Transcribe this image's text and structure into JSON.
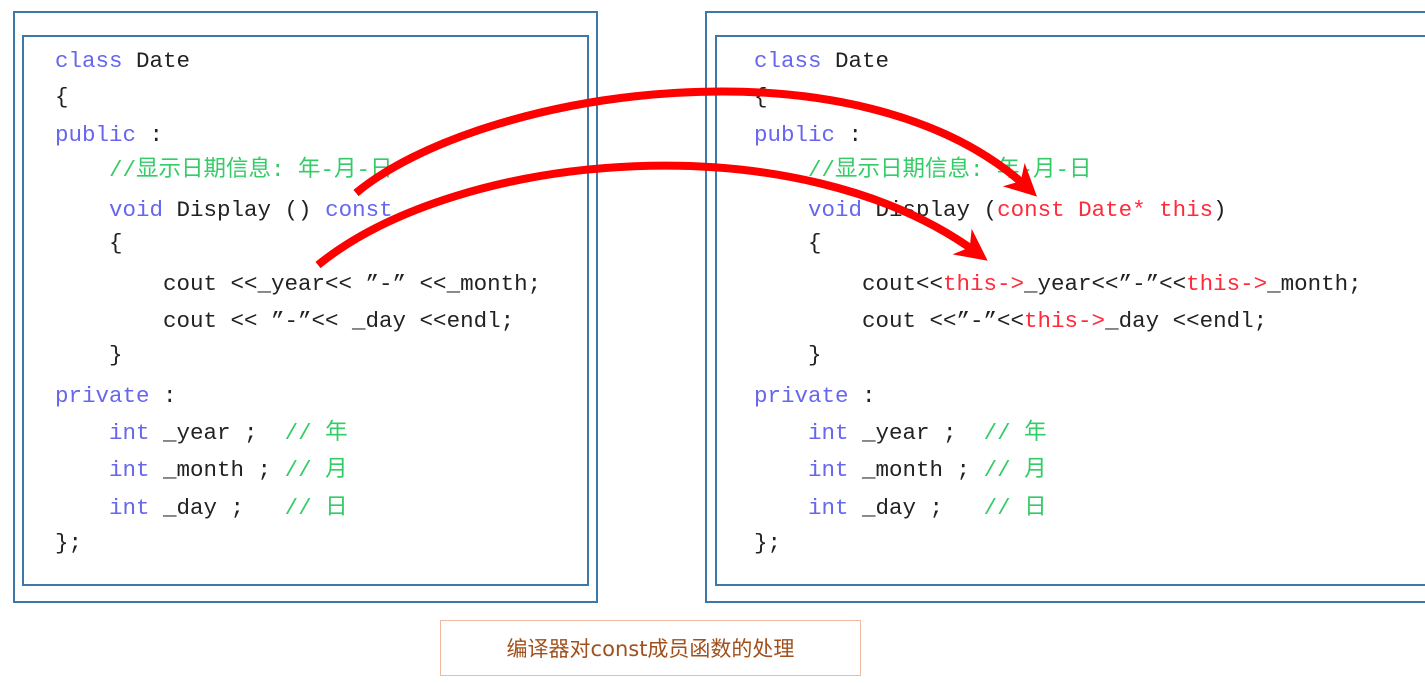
{
  "left_code": [
    [
      [
        "class ",
        "kw"
      ],
      [
        "Date",
        "tx"
      ]
    ],
    [
      [
        "{",
        "tx"
      ]
    ],
    [
      [
        "public",
        "kw"
      ],
      [
        " :",
        "tx"
      ]
    ],
    [
      [
        "    ",
        "tx"
      ],
      [
        "//显示日期信息: 年-月-日",
        "cm"
      ]
    ],
    [
      [
        "    ",
        "tx"
      ],
      [
        "void",
        "kw"
      ],
      [
        " Display () ",
        "tx"
      ],
      [
        "const",
        "kw"
      ]
    ],
    [
      [
        "    {",
        "tx"
      ]
    ],
    [
      [
        "        cout <<_year<< ”-” <<_month;",
        "tx"
      ]
    ],
    [
      [
        "        cout << ”-”<< _day <<endl;",
        "tx"
      ]
    ],
    [
      [
        "    }",
        "tx"
      ]
    ],
    [
      [
        "private",
        "kw"
      ],
      [
        " :",
        "tx"
      ]
    ],
    [
      [
        "    ",
        "tx"
      ],
      [
        "int",
        "kw"
      ],
      [
        " _year ;  ",
        "tx"
      ],
      [
        "// 年",
        "cm"
      ]
    ],
    [
      [
        "    ",
        "tx"
      ],
      [
        "int",
        "kw"
      ],
      [
        " _month ; ",
        "tx"
      ],
      [
        "// 月",
        "cm"
      ]
    ],
    [
      [
        "    ",
        "tx"
      ],
      [
        "int",
        "kw"
      ],
      [
        " _day ;   ",
        "tx"
      ],
      [
        "// 日",
        "cm"
      ]
    ],
    [
      [
        "};",
        "tx"
      ]
    ]
  ],
  "right_code": [
    [
      [
        "class ",
        "kw"
      ],
      [
        "Date",
        "tx"
      ]
    ],
    [
      [
        "{",
        "tx"
      ]
    ],
    [
      [
        "public",
        "kw"
      ],
      [
        " :",
        "tx"
      ]
    ],
    [
      [
        "    ",
        "tx"
      ],
      [
        "//显示日期信息: 年-月-日",
        "cm"
      ]
    ],
    [
      [
        "    ",
        "tx"
      ],
      [
        "void",
        "kw"
      ],
      [
        " Display (",
        "tx"
      ],
      [
        "const Date* this",
        "rd"
      ],
      [
        ")",
        "tx"
      ]
    ],
    [
      [
        "    {",
        "tx"
      ]
    ],
    [
      [
        "        cout<<",
        "tx"
      ],
      [
        "this->",
        "rd"
      ],
      [
        "_year<<”-”<<",
        "tx"
      ],
      [
        "this->",
        "rd"
      ],
      [
        "_month;",
        "tx"
      ]
    ],
    [
      [
        "        cout <<”-”<<",
        "tx"
      ],
      [
        "this->",
        "rd"
      ],
      [
        "_day <<endl;",
        "tx"
      ]
    ],
    [
      [
        "    }",
        "tx"
      ]
    ],
    [
      [
        "private",
        "kw"
      ],
      [
        " :",
        "tx"
      ]
    ],
    [
      [
        "    ",
        "tx"
      ],
      [
        "int",
        "kw"
      ],
      [
        " _year ;  ",
        "tx"
      ],
      [
        "// 年",
        "cm"
      ]
    ],
    [
      [
        "    ",
        "tx"
      ],
      [
        "int",
        "kw"
      ],
      [
        " _month ; ",
        "tx"
      ],
      [
        "// 月",
        "cm"
      ]
    ],
    [
      [
        "    ",
        "tx"
      ],
      [
        "int",
        "kw"
      ],
      [
        " _day ;   ",
        "tx"
      ],
      [
        "// 日",
        "cm"
      ]
    ],
    [
      [
        "};",
        "tx"
      ]
    ]
  ],
  "caption": "编译器对const成员函数的处理",
  "colors": {
    "keyword": "#6666ee",
    "comment": "#33cc66",
    "highlight": "#ff2a3a",
    "arrow": "#ff0000",
    "border": "#3d78aa"
  }
}
